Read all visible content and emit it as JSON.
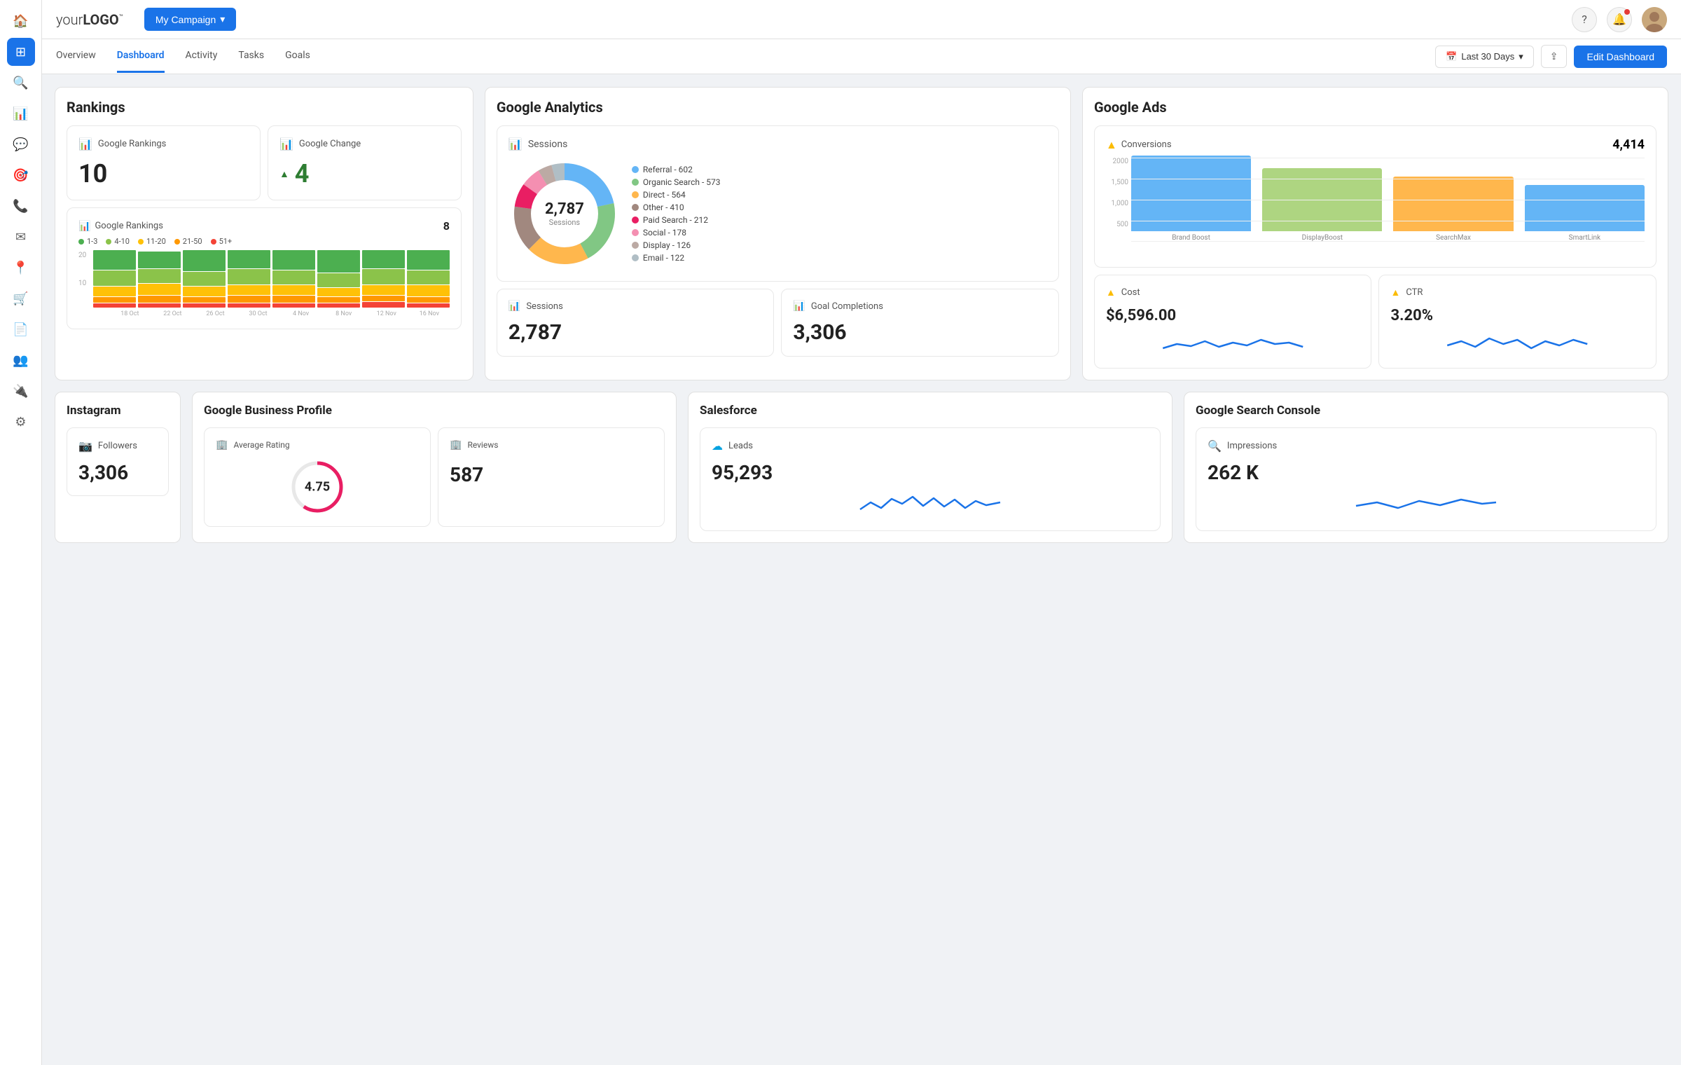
{
  "logo": {
    "text": "your",
    "bold": "LOGO",
    "tm": "™"
  },
  "campaign": {
    "label": "My Campaign"
  },
  "nav_icons": [
    "?",
    "🔔",
    "👤"
  ],
  "tabs": {
    "items": [
      "Overview",
      "Dashboard",
      "Activity",
      "Tasks",
      "Goals"
    ],
    "active": 1
  },
  "date_filter": {
    "label": "Last 30 Days"
  },
  "share_label": "⇪",
  "edit_label": "Edit Dashboard",
  "rankings": {
    "title": "Rankings",
    "google_rankings_card": {
      "icon": "📊",
      "label": "Google Rankings",
      "value": "10"
    },
    "google_change_card": {
      "icon": "📊",
      "label": "Google Change",
      "value": "4"
    },
    "chart_card": {
      "icon": "📊",
      "label": "Google Rankings",
      "count": "8",
      "legend": [
        {
          "label": "1-3",
          "color": "#4caf50"
        },
        {
          "label": "4-10",
          "color": "#8bc34a"
        },
        {
          "label": "11-20",
          "color": "#ffc107"
        },
        {
          "label": "21-50",
          "color": "#ff9800"
        },
        {
          "label": "51+",
          "color": "#f44336"
        }
      ],
      "dates": [
        "18 Oct",
        "22 Oct",
        "26 Oct",
        "30 Oct",
        "4 Nov",
        "8 Nov",
        "12 Nov",
        "16 Nov"
      ],
      "y_labels": [
        "20",
        "",
        "10",
        "",
        ""
      ]
    }
  },
  "google_analytics": {
    "title": "Google Analytics",
    "sessions_donut": {
      "icon": "📊",
      "label": "Sessions",
      "total": "2,787",
      "center_label": "Sessions",
      "legend": [
        {
          "label": "Referral - 602",
          "color": "#64b5f6",
          "value": 602
        },
        {
          "label": "Organic Search - 573",
          "color": "#81c784",
          "value": 573
        },
        {
          "label": "Direct - 564",
          "color": "#ffb74d",
          "value": 564
        },
        {
          "label": "Other - 410",
          "color": "#a1887f",
          "value": 410
        },
        {
          "label": "Paid Search - 212",
          "color": "#e91e63",
          "value": 212
        },
        {
          "label": "Social - 178",
          "color": "#f48fb1",
          "value": 178
        },
        {
          "label": "Display - 126",
          "color": "#bcaaa4",
          "value": 126
        },
        {
          "label": "Email - 122",
          "color": "#b0bec5",
          "value": 122
        }
      ]
    },
    "sessions_card": {
      "icon": "📊",
      "label": "Sessions",
      "value": "2,787"
    },
    "goal_completions_card": {
      "icon": "📊",
      "label": "Goal Completions",
      "value": "3,306"
    }
  },
  "google_ads": {
    "title": "Google Ads",
    "conversions": {
      "icon": "▲",
      "label": "Conversions",
      "total": "4,414",
      "bars": [
        {
          "label": "Brand Boost",
          "value": 1800,
          "color": "#64b5f6"
        },
        {
          "label": "DisplayBoost",
          "value": 1500,
          "color": "#aed581"
        },
        {
          "label": "SearchMax",
          "value": 1300,
          "color": "#ffb74d"
        },
        {
          "label": "SmartLink",
          "value": 1100,
          "color": "#64b5f6"
        }
      ],
      "max": 2000,
      "y_labels": [
        "2000",
        "1,500",
        "1,000",
        "500",
        ""
      ]
    },
    "cost_card": {
      "icon": "▲",
      "label": "Cost",
      "value": "$6,596.00"
    },
    "ctr_card": {
      "icon": "▲",
      "label": "CTR",
      "value": "3.20%"
    }
  },
  "instagram": {
    "title": "Instagram",
    "followers_card": {
      "icon": "📷",
      "label": "Followers",
      "value": "3,306"
    }
  },
  "google_business": {
    "title": "Google Business Profile",
    "avg_rating_card": {
      "icon": "🏢",
      "label": "Average Rating",
      "value": "4.75"
    },
    "reviews_card": {
      "icon": "🏢",
      "label": "Reviews",
      "value": "587"
    }
  },
  "salesforce": {
    "title": "Salesforce",
    "leads_card": {
      "icon": "☁",
      "label": "Leads",
      "value": "95,293"
    }
  },
  "search_console": {
    "title": "Google Search Console",
    "impressions_card": {
      "icon": "🔍",
      "label": "Impressions",
      "value": "262 K"
    }
  },
  "colors": {
    "blue": "#1a73e8",
    "green": "#2e7d32",
    "light_blue": "#64b5f6",
    "accent": "#e91e63"
  }
}
